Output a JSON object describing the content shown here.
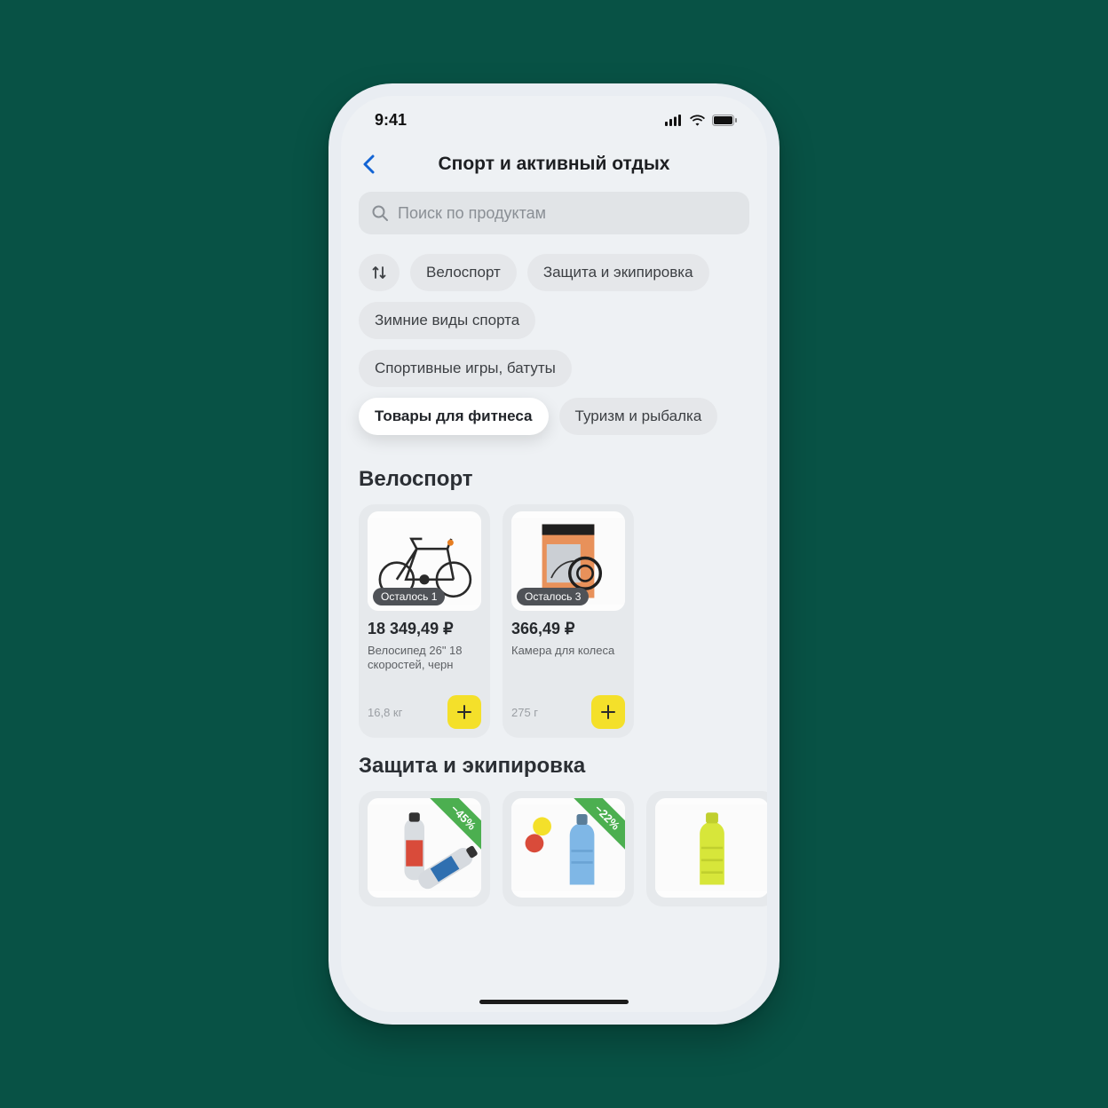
{
  "status": {
    "time": "9:41"
  },
  "header": {
    "title": "Спорт и активный отдых"
  },
  "search": {
    "placeholder": "Поиск по продуктам"
  },
  "chips": [
    {
      "label": "Велоспорт",
      "active": false
    },
    {
      "label": "Защита и экипировка",
      "active": false
    },
    {
      "label": "Зимние виды спорта",
      "active": false
    },
    {
      "label": "Спортивные игры, батуты",
      "active": false
    },
    {
      "label": "Товары для фитнеса",
      "active": true
    },
    {
      "label": "Туризм и рыбалка",
      "active": false
    }
  ],
  "sections": [
    {
      "title": "Велоспорт",
      "products": [
        {
          "price": "18 349,49 ₽",
          "name": "Велосипед 26\" 18 скоростей, черн",
          "weight": "16,8 кг",
          "badge": "Осталось 1"
        },
        {
          "price": "366,49 ₽",
          "name": "Камера для колеса",
          "weight": "275 г",
          "badge": "Осталось 3"
        }
      ]
    },
    {
      "title": "Защита и экипировка",
      "products": [
        {
          "discount": "−45%"
        },
        {
          "discount": "−22%"
        },
        {
          "discount": ""
        }
      ]
    }
  ]
}
